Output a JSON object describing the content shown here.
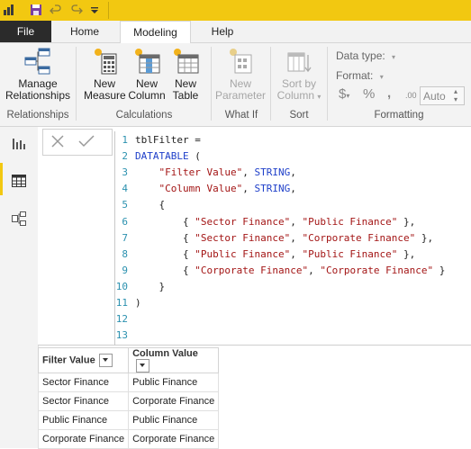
{
  "titlebar": {
    "icons": [
      "powerbi-logo",
      "save-icon",
      "undo-icon",
      "redo-icon",
      "customize-icon"
    ]
  },
  "tabs": [
    {
      "label": "File",
      "active": false
    },
    {
      "label": "Home",
      "active": false
    },
    {
      "label": "Modeling",
      "active": true
    },
    {
      "label": "Help",
      "active": false
    }
  ],
  "ribbon": {
    "relationships": {
      "button_line1": "Manage",
      "button_line2": "Relationships",
      "group_label": "Relationships"
    },
    "calculations": {
      "new_measure": {
        "line1": "New",
        "line2": "Measure"
      },
      "new_column": {
        "line1": "New",
        "line2": "Column"
      },
      "new_table": {
        "line1": "New",
        "line2": "Table"
      },
      "group_label": "Calculations"
    },
    "whatif": {
      "line1": "New",
      "line2": "Parameter",
      "group_label": "What If"
    },
    "sort": {
      "line1": "Sort by",
      "line2": "Column",
      "group_label": "Sort"
    },
    "formatting": {
      "data_type_label": "Data type:",
      "format_label": "Format:",
      "currency_symbol": "$",
      "percent_symbol": "%",
      "comma_symbol": ",",
      "decimal_symbol": ".00",
      "auto_value": "Auto",
      "group_label": "Formatting"
    }
  },
  "editor": {
    "lines": [
      {
        "n": "1",
        "text": "tblFilter ="
      },
      {
        "n": "2",
        "text": "DATATABLE ("
      },
      {
        "n": "3",
        "text": "    \"Filter Value\", STRING,"
      },
      {
        "n": "4",
        "text": "    \"Column Value\", STRING,"
      },
      {
        "n": "5",
        "text": "    {"
      },
      {
        "n": "6",
        "text": "        { \"Sector Finance\", \"Public Finance\" },"
      },
      {
        "n": "7",
        "text": "        { \"Sector Finance\", \"Corporate Finance\" },"
      },
      {
        "n": "8",
        "text": "        { \"Public Finance\", \"Public Finance\" },"
      },
      {
        "n": "9",
        "text": "        { \"Corporate Finance\", \"Corporate Finance\" }"
      },
      {
        "n": "10",
        "text": "    }"
      },
      {
        "n": "11",
        "text": ")"
      },
      {
        "n": "12",
        "text": ""
      },
      {
        "n": "13",
        "text": ""
      }
    ]
  },
  "table": {
    "columns": [
      "Filter Value",
      "Column Value"
    ],
    "rows": [
      [
        "Sector Finance",
        "Public Finance"
      ],
      [
        "Sector Finance",
        "Corporate Finance"
      ],
      [
        "Public Finance",
        "Public Finance"
      ],
      [
        "Corporate Finance",
        "Corporate Finance"
      ]
    ]
  },
  "colors": {
    "accent": "#f2c811",
    "file_tab": "#2b2b2b",
    "keyword": "#1e3fc9",
    "string": "#a31515",
    "line_number": "#2b91af"
  }
}
